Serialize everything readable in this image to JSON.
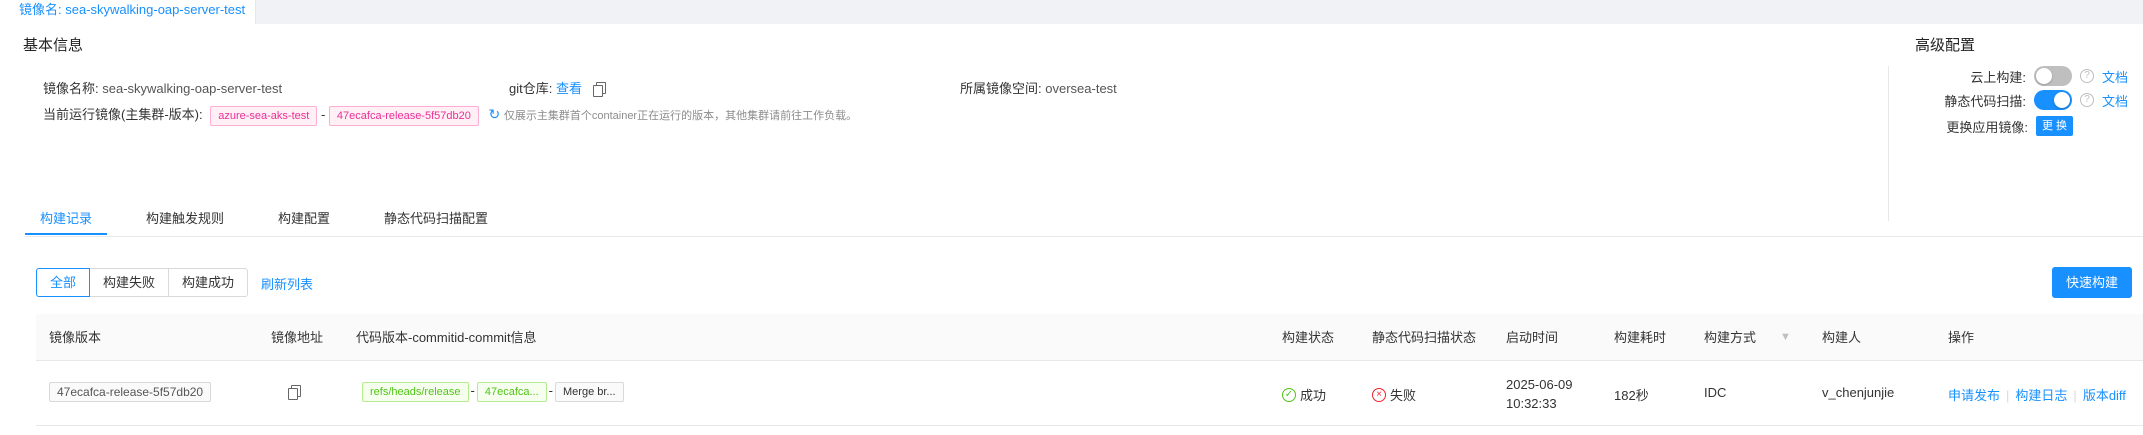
{
  "top_tab": {
    "label": "镜像名: sea-skywalking-oap-server-test"
  },
  "basic_info": {
    "title": "基本信息",
    "image_name_label": "镜像名称:",
    "image_name_value": "sea-skywalking-oap-server-test",
    "git_label": "git仓库:",
    "git_link": "查看",
    "space_label": "所属镜像空间:",
    "space_value": "oversea-test",
    "running_label": "当前运行镜像(主集群-版本):",
    "cluster_tag": "azure-sea-aks-test",
    "dash": "-",
    "version_tag": "47ecafca-release-5f57db20",
    "note": "仅展示主集群首个container正在运行的版本，其他集群请前往工作负载。"
  },
  "advanced": {
    "title": "高级配置",
    "cloud_build_label": "云上构建:",
    "static_scan_label": "静态代码扫描:",
    "replace_image_label": "更换应用镜像:",
    "doc_link": "文档",
    "replace_button": "更 换",
    "cloud_build_on": false,
    "static_scan_on": true
  },
  "tabs": [
    "构建记录",
    "构建触发规则",
    "构建配置",
    "静态代码扫描配置"
  ],
  "filters": [
    "全部",
    "构建失败",
    "构建成功"
  ],
  "refresh_label": "刷新列表",
  "quick_build_label": "快速构建",
  "table": {
    "headers": [
      "镜像版本",
      "镜像地址",
      "代码版本-commitid-commit信息",
      "构建状态",
      "静态代码扫描状态",
      "启动时间",
      "构建耗时",
      "构建方式",
      "构建人",
      "操作"
    ],
    "rows": [
      {
        "version": "47ecafca-release-5f57db20",
        "ref": "refs/heads/release",
        "commit": "47ecafca...",
        "message": "Merge br...",
        "build_status": "成功",
        "scan_status": "失败",
        "start_date": "2025-06-09",
        "start_time": "10:32:33",
        "duration": "182秒",
        "method": "IDC",
        "builder": "v_chenjunjie",
        "actions": [
          "申请发布",
          "构建日志",
          "版本diff"
        ]
      }
    ]
  },
  "colors": {
    "accent": "#1890ff",
    "success": "#52c41a",
    "error": "#f5222d",
    "tag_pink": "#eb2f96"
  }
}
